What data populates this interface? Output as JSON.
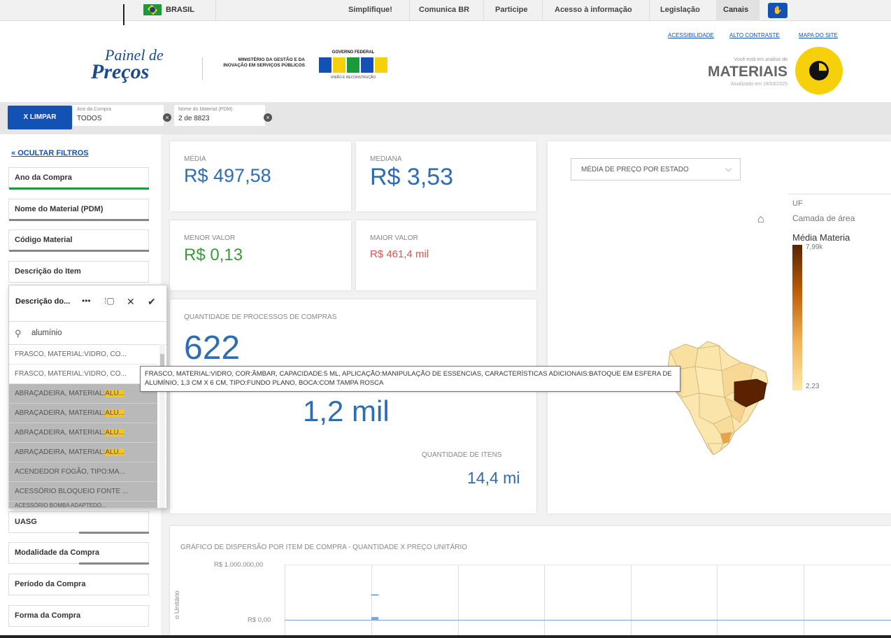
{
  "govbar": {
    "country": "BRASIL",
    "links": [
      "Simplifique!",
      "Comunica BR",
      "Participe",
      "Acesso à informação",
      "Legislação"
    ],
    "canais": "Canais"
  },
  "header": {
    "accessibility_links": [
      "ACESSIBILIDADE",
      "ALTO CONTRASTE",
      "MAPA DO SITE"
    ],
    "logo_line1": "Painel de",
    "logo_line2": "Preços",
    "ministry": "MINISTÉRIO DA GESTÃO E DA INOVAÇÃO EM SERVIÇOS PÚBLICOS",
    "gov_label": "GOVERNO FEDERAL",
    "gov_sub": "UNIÃO E RECONSTRUÇÃO",
    "analysis_small": "Você está em análise de",
    "analysis_title": "MATERIAIS",
    "updated": "Atualizado em 18/03/2025"
  },
  "filterbar": {
    "clear_label": "X  LIMPAR",
    "chips": [
      {
        "label": "Ano da Compra",
        "value": "TODOS"
      },
      {
        "label": "Nome do Material (PDM)",
        "value": "2 de 8823"
      }
    ]
  },
  "sidebar": {
    "hide_filters": "OCULTAR FILTROS",
    "filters": [
      "Ano da Compra",
      "Nome do Material (PDM)",
      "Código Material",
      "Descrição do Item",
      "UASG",
      "Modalidade da Compra",
      "Período da Compra",
      "Forma da Compra"
    ]
  },
  "dropdown": {
    "title": "Descrição do...",
    "search_value": "alumínio",
    "items": [
      {
        "text": "FRASCO, MATERIAL:VIDRO, CO...",
        "pre": "FRASCO, MATERIAL:VIDRO, CO...",
        "hl": "",
        "selected": false
      },
      {
        "text": "FRASCO, MATERIAL:VIDRO, CO...",
        "pre": "FRASCO, MATERIAL:VIDRO, CO...",
        "hl": "",
        "selected": false
      },
      {
        "text": "ABRAÇADEIRA, MATERIAL:ALU...",
        "pre": "ABRAÇADEIRA, MATERIAL:",
        "hl": "ALU...",
        "selected": true
      },
      {
        "text": "ABRAÇADEIRA, MATERIAL:ALU...",
        "pre": "ABRAÇADEIRA, MATERIAL:",
        "hl": "ALU...",
        "selected": true
      },
      {
        "text": "ABRAÇADEIRA, MATERIAL:ALU...",
        "pre": "ABRAÇADEIRA, MATERIAL:",
        "hl": "ALU...",
        "selected": true
      },
      {
        "text": "ABRAÇADEIRA, MATERIAL:ALU...",
        "pre": "ABRAÇADEIRA, MATERIAL:",
        "hl": "ALU...",
        "selected": true
      },
      {
        "text": "ACENDEDOR FOGÃO, TIPO:MA...",
        "pre": "ACENDEDOR FOGÃO, TIPO:MA...",
        "hl": "",
        "selected": true
      },
      {
        "text": "ACESSÓRIO BLOQUEIO FONTE ...",
        "pre": "ACESSÓRIO BLOQUEIO FONTE ...",
        "hl": "",
        "selected": true
      },
      {
        "text": "ACESSÓRIO BOMBA ADAPTEDO...",
        "pre": "ACESSÓRIO BOMBA ADAPTEDO...",
        "hl": "",
        "selected": true
      }
    ]
  },
  "tooltip": "FRASCO, MATERIAL:VIDRO, COR:ÂMBAR, CAPACIDADE:5 ML, APLICAÇÃO:MANIPULAÇÃO DE ESSENCIAS, CARACTERÍSTICAS ADICIONAIS:BATOQUE EM ESFERA DE ALUMÍNIO, 1,3 CM X 6 CM, TIPO:FUNDO PLANO, BOCA:COM TAMPA ROSCA",
  "kpis": {
    "media_label": "MÉDIA",
    "media_value": "R$ 497,58",
    "mediana_label": "MEDIANA",
    "mediana_value": "R$ 3,53",
    "menor_label": "MENOR VALOR",
    "menor_value": "R$ 0,13",
    "maior_label": "MAIOR VALOR",
    "maior_value": "R$ 461,4 mil",
    "processos_label": "QUANTIDADE DE PROCESSOS DE COMPRAS",
    "processos_value": "622",
    "compras_value": "1,2 mil",
    "itens_label": "QUANTIDADE DE ITENS",
    "itens_value": "14,4 mi"
  },
  "map": {
    "select_label": "MÉDIA DE PREÇO POR ESTADO",
    "legend_uf": "UF",
    "legend_layer": "Camada de área",
    "legend_metric": "Média Materia",
    "legend_max": "7,99k",
    "legend_min": "2,23",
    "colors": {
      "max": "#5a2200",
      "min": "#fde7a7"
    }
  },
  "scatter": {
    "title": "GRÁFICO DE DISPERSÃO POR ITEM DE COMPRA - QUANTIDADE X PREÇO UNITÁRIO",
    "y_ticks": [
      "R$ 1.000.000,00",
      "R$ 0,00"
    ],
    "y_label": "o Unitário"
  },
  "colors": {
    "accent": "#1351b4",
    "value_blue": "#2e6db4",
    "green": "#3a9b3a",
    "red": "#d9534f",
    "yellow": "#f5d00b"
  }
}
